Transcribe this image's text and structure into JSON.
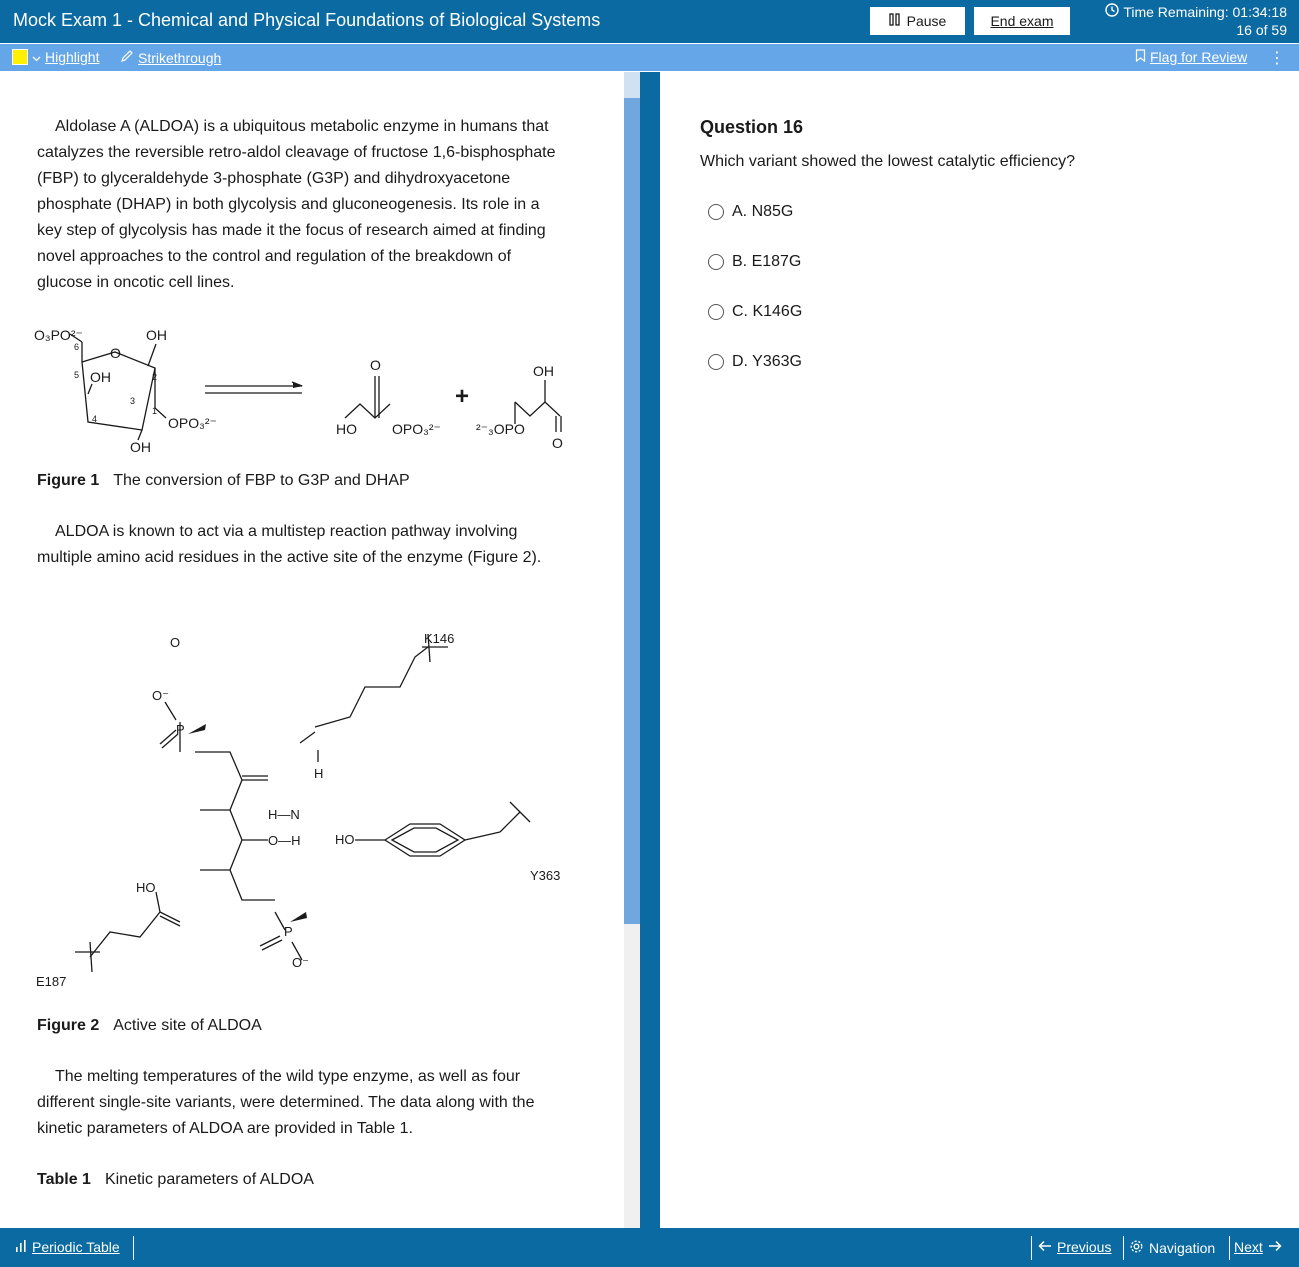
{
  "header": {
    "title": "Mock Exam 1 - Chemical and Physical Foundations of Biological Systems",
    "pause_label": "Pause",
    "end_label": "End exam",
    "timer_label": "Time Remaining: 01:34:18",
    "progress": "16 of 59"
  },
  "toolbar": {
    "highlight_label": "Highlight",
    "strikethrough_label": "Strikethrough",
    "flag_label": "Flag for Review",
    "highlight_color": "#ffef00"
  },
  "passage": {
    "para1": "Aldolase A (ALDOA) is a ubiquitous metabolic enzyme in humans that catalyzes the reversible retro-aldol cleavage of fructose 1,6-bisphosphate (FBP) to glyceraldehyde 3-phosphate (G3P) and dihydroxyacetone phosphate (DHAP) in both glycolysis and gluconeogenesis. Its role in a key step of glycolysis has made it the focus of research aimed at finding novel approaches to the control and regulation of the breakdown of glucose in oncotic cell lines.",
    "fig1_label": "Figure 1",
    "fig1_caption": "The conversion of FBP to G3P and DHAP",
    "para2": "ALDOA is known to act via a multistep reaction pathway involving multiple amino acid residues in the active site of the enzyme (Figure 2).",
    "fig2_label": "Figure 2",
    "fig2_caption": "Active site of ALDOA",
    "para3": "The melting temperatures of the wild type enzyme, as well as four different single-site variants, were determined. The data along with the kinetic parameters of ALDOA are provided in Table 1.",
    "table1_label": "Table 1",
    "table1_caption": "Kinetic parameters of ALDOA"
  },
  "figure1": {
    "o3po": "O₃PO²⁻",
    "oh_top": "OH",
    "ring_o": "O",
    "oh_ring": "OH",
    "oh_bottom": "OH",
    "opo3": "OPO₃²⁻",
    "n6": "6",
    "n5": "5",
    "n4": "4",
    "n3": "3",
    "n2": "2",
    "n1": "1",
    "dhap_o": "O",
    "dhap_ho": "HO",
    "dhap_opo3": "OPO₃²⁻",
    "plus": "+",
    "g3p_oh": "OH",
    "g3p_opo": "²⁻₃OPO",
    "g3p_o": "O"
  },
  "figure2": {
    "k146": "K146",
    "y363": "Y363",
    "e187": "E187",
    "hn": "H—N",
    "h": "H",
    "oh_link": "O—H",
    "ho_tyr": "HO",
    "ho_glu": "HO",
    "o": "O",
    "p": "P",
    "o_minus": "O⁻"
  },
  "question": {
    "title": "Question 16",
    "text": "Which variant showed the lowest catalytic efficiency?",
    "choices": [
      {
        "label": "A. N85G"
      },
      {
        "label": "B. E187G"
      },
      {
        "label": "C. K146G"
      },
      {
        "label": "D. Y363G"
      }
    ]
  },
  "footer": {
    "periodic_label": "Periodic Table",
    "previous_label": "Previous",
    "navigation_label": "Navigation",
    "next_label": "Next"
  },
  "colors": {
    "header_bg": "#0a6aa1",
    "toolbar_bg": "#64a6e8",
    "scroll_thumb": "#6fa7de"
  }
}
